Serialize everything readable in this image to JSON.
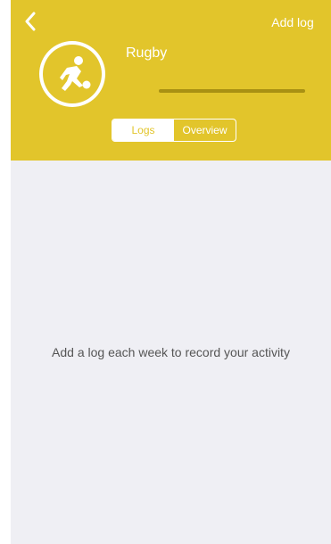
{
  "header": {
    "title": "Rugby",
    "add_log_label": "Add log",
    "back_icon": "chevron-left-icon",
    "activity_icon": "rugby-player-icon"
  },
  "tabs": {
    "logs_label": "Logs",
    "overview_label": "Overview",
    "selected": "Logs"
  },
  "empty_state": {
    "message": "Add a log each week to record your activity"
  },
  "colors": {
    "accent": "#e2c52b",
    "background": "#efeff4",
    "text": "#555555"
  }
}
